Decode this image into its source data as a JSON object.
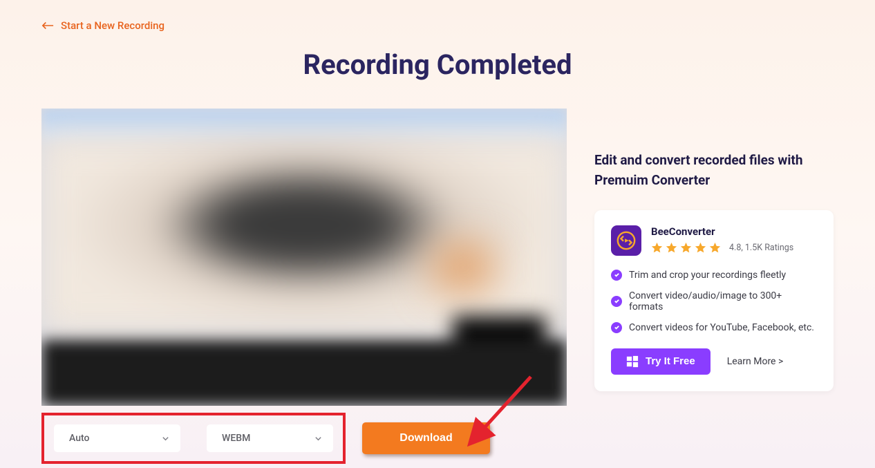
{
  "back_link": "Start a New Recording",
  "page_title": "Recording Completed",
  "select_quality": "Auto",
  "select_format": "WEBM",
  "download_label": "Download",
  "right_heading": "Edit and convert recorded files with Premuim Converter",
  "promo": {
    "name": "BeeConverter",
    "rating_text": "4.8, 1.5K Ratings",
    "features": [
      "Trim and crop your recordings fleetly",
      "Convert video/audio/image to 300+ formats",
      "Convert videos for YouTube, Facebook, etc."
    ],
    "try_label": "Try It Free",
    "learn_more": "Learn More >"
  },
  "colors": {
    "accent_orange": "#f37a1f",
    "accent_purple": "#8a3dff",
    "highlight_red": "#e4232e",
    "title_navy": "#2b2560"
  }
}
